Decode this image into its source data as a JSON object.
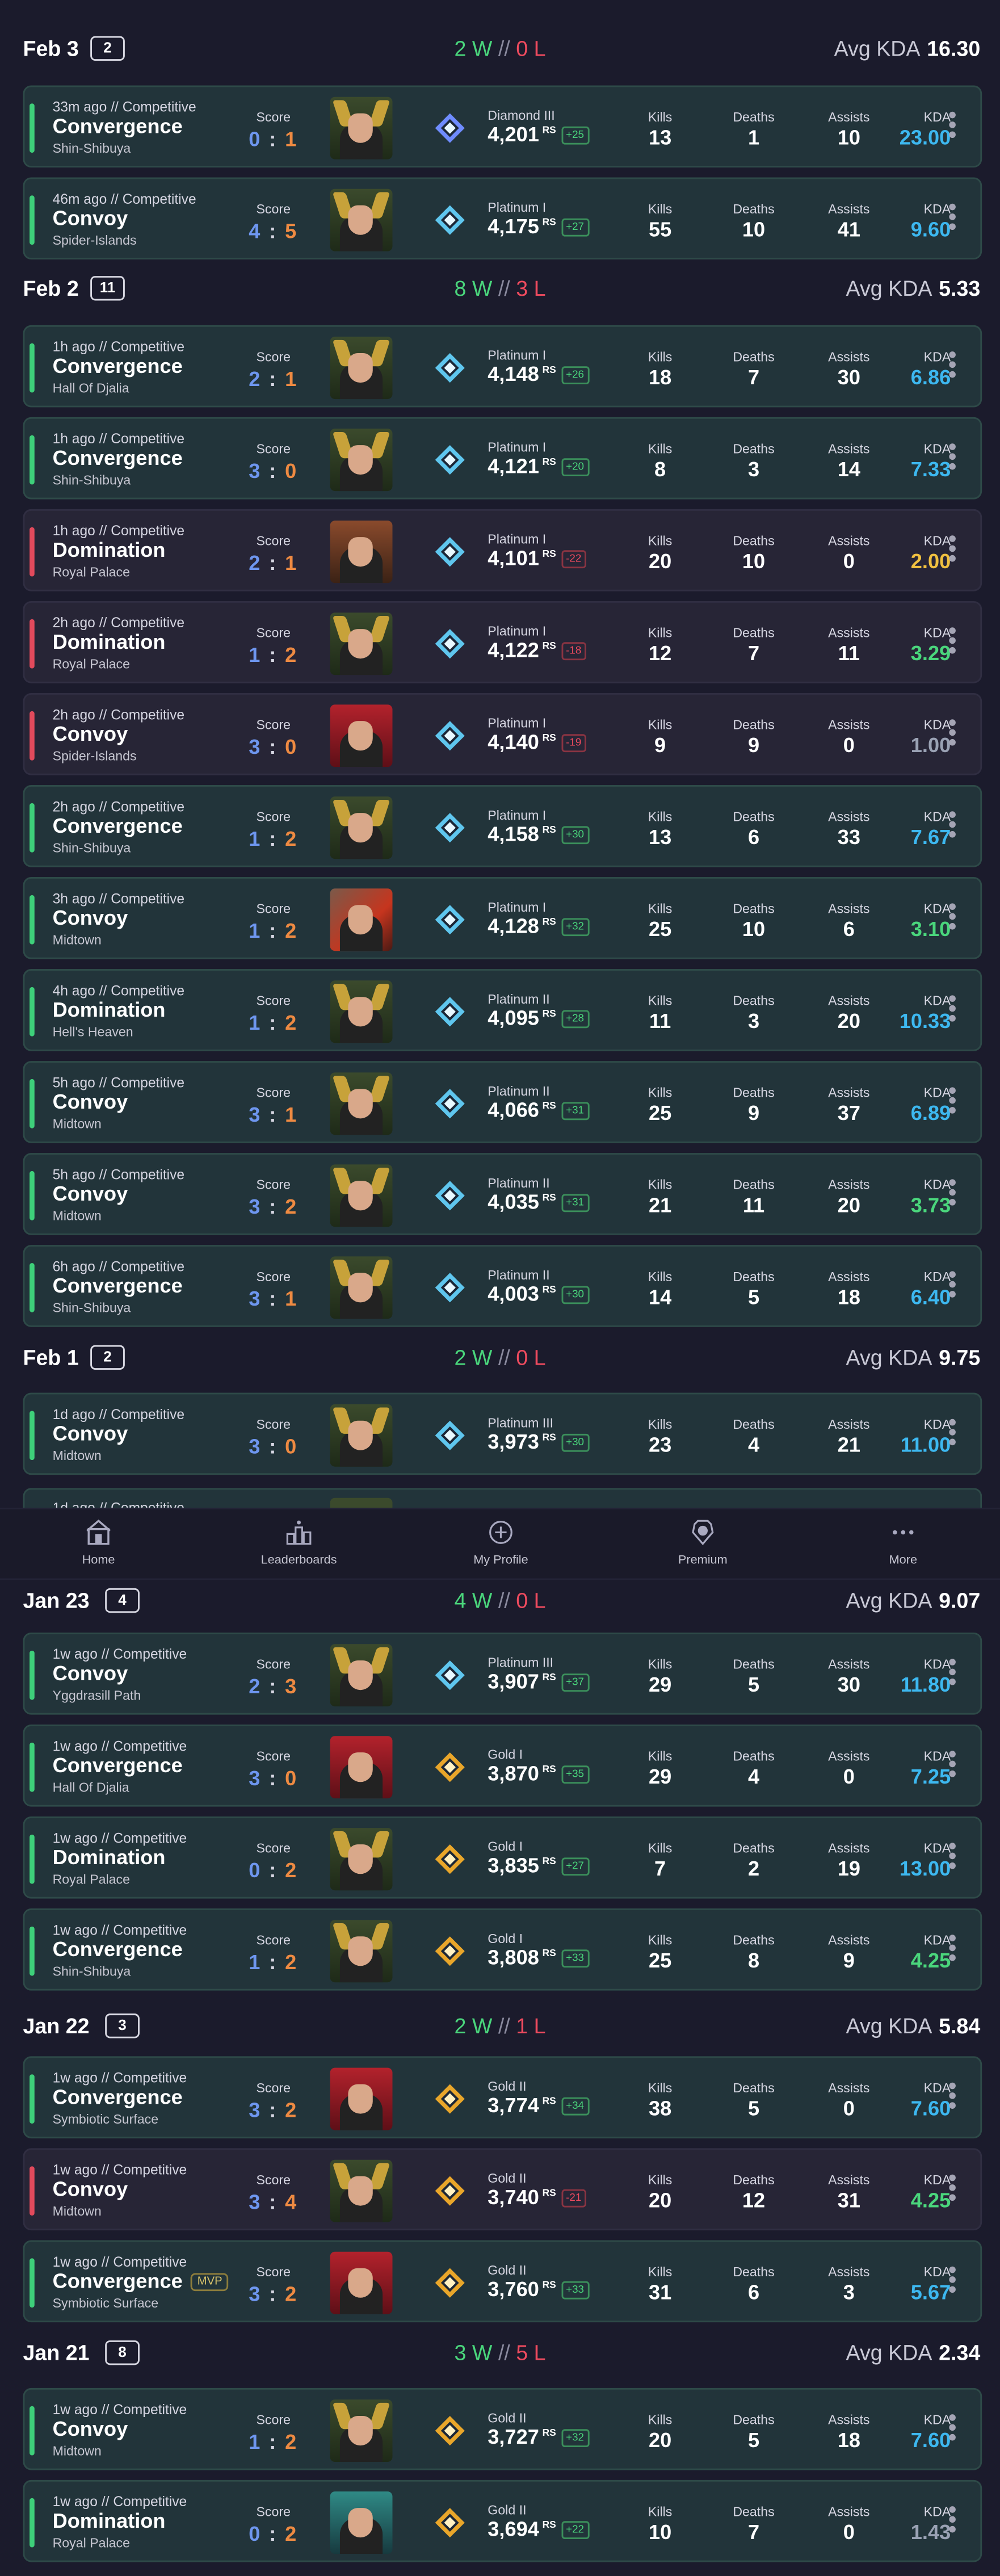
{
  "colors": {
    "background": "#1b1b2c",
    "win": "#3ed07a",
    "loss": "#e24a5c",
    "kda_blue": "#3db8f0",
    "kda_green": "#4ad67c",
    "kda_yellow": "#f0c040"
  },
  "nav": {
    "items": [
      {
        "label": "Home",
        "icon": "home-icon"
      },
      {
        "label": "Leaderboards",
        "icon": "leaderboard-icon"
      },
      {
        "label": "My Profile",
        "icon": "profile-plus-icon"
      },
      {
        "label": "Premium",
        "icon": "premium-icon"
      },
      {
        "label": "More",
        "icon": "more-dots-icon"
      }
    ]
  },
  "partial_match": {
    "meta": "1d ago // Competitive"
  },
  "days": [
    {
      "date": "Feb 3",
      "count": "2",
      "wins": "2 W",
      "sep": "//",
      "losses": "0 L",
      "avg_label": "Avg KDA",
      "avg_kda": "16.30",
      "matches": [
        {
          "time": "33m ago",
          "sep": "//",
          "queue": "Competitive",
          "mode": "Convergence",
          "map": "Shin-Shibuya",
          "score_label": "Score",
          "score_a": "0",
          "score_b": "1",
          "hero": "green",
          "rank_icon": "diamond",
          "tier": "Diamond III",
          "rs": "4,201",
          "rs_unit": "RS",
          "delta": "+25",
          "result": "win",
          "kills_label": "Kills",
          "kills": "13",
          "deaths_label": "Deaths",
          "deaths": "1",
          "assists_label": "Assists",
          "assists": "10",
          "kda_label": "KDA",
          "kda": "23.00",
          "kda_color": "blue"
        },
        {
          "time": "46m ago",
          "sep": "//",
          "queue": "Competitive",
          "mode": "Convoy",
          "map": "Spider-Islands",
          "score_label": "Score",
          "score_a": "4",
          "score_b": "5",
          "hero": "green",
          "rank_icon": "platinum",
          "tier": "Platinum I",
          "rs": "4,175",
          "rs_unit": "RS",
          "delta": "+27",
          "result": "win",
          "kills_label": "Kills",
          "kills": "55",
          "deaths_label": "Deaths",
          "deaths": "10",
          "assists_label": "Assists",
          "assists": "41",
          "kda_label": "KDA",
          "kda": "9.60",
          "kda_color": "blue"
        }
      ]
    },
    {
      "date": "Feb 2",
      "count": "11",
      "wins": "8 W",
      "sep": "//",
      "losses": "3 L",
      "avg_label": "Avg KDA",
      "avg_kda": "5.33",
      "matches": [
        {
          "time": "1h ago",
          "sep": "//",
          "queue": "Competitive",
          "mode": "Convergence",
          "map": "Hall Of Djalia",
          "score_label": "Score",
          "score_a": "2",
          "score_b": "1",
          "hero": "green",
          "rank_icon": "platinum",
          "tier": "Platinum I",
          "rs": "4,148",
          "rs_unit": "RS",
          "delta": "+26",
          "result": "win",
          "kills_label": "Kills",
          "kills": "18",
          "deaths_label": "Deaths",
          "deaths": "7",
          "assists_label": "Assists",
          "assists": "30",
          "kda_label": "KDA",
          "kda": "6.86",
          "kda_color": "blue"
        },
        {
          "time": "1h ago",
          "sep": "//",
          "queue": "Competitive",
          "mode": "Convergence",
          "map": "Shin-Shibuya",
          "score_label": "Score",
          "score_a": "3",
          "score_b": "0",
          "hero": "green",
          "rank_icon": "platinum",
          "tier": "Platinum I",
          "rs": "4,121",
          "rs_unit": "RS",
          "delta": "+20",
          "result": "win",
          "kills_label": "Kills",
          "kills": "8",
          "deaths_label": "Deaths",
          "deaths": "3",
          "assists_label": "Assists",
          "assists": "14",
          "kda_label": "KDA",
          "kda": "7.33",
          "kda_color": "blue"
        },
        {
          "time": "1h ago",
          "sep": "//",
          "queue": "Competitive",
          "mode": "Domination",
          "map": "Royal Palace",
          "score_label": "Score",
          "score_a": "2",
          "score_b": "1",
          "hero": "brown",
          "rank_icon": "platinum",
          "tier": "Platinum I",
          "rs": "4,101",
          "rs_unit": "RS",
          "delta": "-22",
          "result": "loss",
          "kills_label": "Kills",
          "kills": "20",
          "deaths_label": "Deaths",
          "deaths": "10",
          "assists_label": "Assists",
          "assists": "0",
          "kda_label": "KDA",
          "kda": "2.00",
          "kda_color": "yellow"
        },
        {
          "time": "2h ago",
          "sep": "//",
          "queue": "Competitive",
          "mode": "Domination",
          "map": "Royal Palace",
          "score_label": "Score",
          "score_a": "1",
          "score_b": "2",
          "hero": "green",
          "rank_icon": "platinum",
          "tier": "Platinum I",
          "rs": "4,122",
          "rs_unit": "RS",
          "delta": "-18",
          "result": "loss",
          "kills_label": "Kills",
          "kills": "12",
          "deaths_label": "Deaths",
          "deaths": "7",
          "assists_label": "Assists",
          "assists": "11",
          "kda_label": "KDA",
          "kda": "3.29",
          "kda_color": "green"
        },
        {
          "time": "2h ago",
          "sep": "//",
          "queue": "Competitive",
          "mode": "Convoy",
          "map": "Spider-Islands",
          "score_label": "Score",
          "score_a": "3",
          "score_b": "0",
          "hero": "red",
          "rank_icon": "platinum",
          "tier": "Platinum I",
          "rs": "4,140",
          "rs_unit": "RS",
          "delta": "-19",
          "result": "loss",
          "kills_label": "Kills",
          "kills": "9",
          "deaths_label": "Deaths",
          "deaths": "9",
          "assists_label": "Assists",
          "assists": "0",
          "kda_label": "KDA",
          "kda": "1.00",
          "kda_color": "grey"
        },
        {
          "time": "2h ago",
          "sep": "//",
          "queue": "Competitive",
          "mode": "Convergence",
          "map": "Shin-Shibuya",
          "score_label": "Score",
          "score_a": "1",
          "score_b": "2",
          "hero": "green",
          "rank_icon": "platinum",
          "tier": "Platinum I",
          "rs": "4,158",
          "rs_unit": "RS",
          "delta": "+30",
          "result": "win",
          "kills_label": "Kills",
          "kills": "13",
          "deaths_label": "Deaths",
          "deaths": "6",
          "assists_label": "Assists",
          "assists": "33",
          "kda_label": "KDA",
          "kda": "7.67",
          "kda_color": "blue"
        },
        {
          "time": "3h ago",
          "sep": "//",
          "queue": "Competitive",
          "mode": "Convoy",
          "map": "Midtown",
          "score_label": "Score",
          "score_a": "1",
          "score_b": "2",
          "hero": "mix",
          "rank_icon": "platinum",
          "tier": "Platinum I",
          "rs": "4,128",
          "rs_unit": "RS",
          "delta": "+32",
          "result": "win",
          "kills_label": "Kills",
          "kills": "25",
          "deaths_label": "Deaths",
          "deaths": "10",
          "assists_label": "Assists",
          "assists": "6",
          "kda_label": "KDA",
          "kda": "3.10",
          "kda_color": "green"
        },
        {
          "time": "4h ago",
          "sep": "//",
          "queue": "Competitive",
          "mode": "Domination",
          "map": "Hell's Heaven",
          "score_label": "Score",
          "score_a": "1",
          "score_b": "2",
          "hero": "green",
          "rank_icon": "platinum",
          "tier": "Platinum II",
          "rs": "4,095",
          "rs_unit": "RS",
          "delta": "+28",
          "result": "win",
          "kills_label": "Kills",
          "kills": "11",
          "deaths_label": "Deaths",
          "deaths": "3",
          "assists_label": "Assists",
          "assists": "20",
          "kda_label": "KDA",
          "kda": "10.33",
          "kda_color": "blue"
        },
        {
          "time": "5h ago",
          "sep": "//",
          "queue": "Competitive",
          "mode": "Convoy",
          "map": "Midtown",
          "score_label": "Score",
          "score_a": "3",
          "score_b": "1",
          "hero": "green",
          "rank_icon": "platinum",
          "tier": "Platinum II",
          "rs": "4,066",
          "rs_unit": "RS",
          "delta": "+31",
          "result": "win",
          "kills_label": "Kills",
          "kills": "25",
          "deaths_label": "Deaths",
          "deaths": "9",
          "assists_label": "Assists",
          "assists": "37",
          "kda_label": "KDA",
          "kda": "6.89",
          "kda_color": "blue"
        },
        {
          "time": "5h ago",
          "sep": "//",
          "queue": "Competitive",
          "mode": "Convoy",
          "map": "Midtown",
          "score_label": "Score",
          "score_a": "3",
          "score_b": "2",
          "hero": "green",
          "rank_icon": "platinum",
          "tier": "Platinum II",
          "rs": "4,035",
          "rs_unit": "RS",
          "delta": "+31",
          "result": "win",
          "kills_label": "Kills",
          "kills": "21",
          "deaths_label": "Deaths",
          "deaths": "11",
          "assists_label": "Assists",
          "assists": "20",
          "kda_label": "KDA",
          "kda": "3.73",
          "kda_color": "green"
        },
        {
          "time": "6h ago",
          "sep": "//",
          "queue": "Competitive",
          "mode": "Convergence",
          "map": "Shin-Shibuya",
          "score_label": "Score",
          "score_a": "3",
          "score_b": "1",
          "hero": "green",
          "rank_icon": "platinum",
          "tier": "Platinum II",
          "rs": "4,003",
          "rs_unit": "RS",
          "delta": "+30",
          "result": "win",
          "kills_label": "Kills",
          "kills": "14",
          "deaths_label": "Deaths",
          "deaths": "5",
          "assists_label": "Assists",
          "assists": "18",
          "kda_label": "KDA",
          "kda": "6.40",
          "kda_color": "blue"
        }
      ]
    },
    {
      "date": "Feb 1",
      "count": "2",
      "wins": "2 W",
      "sep": "//",
      "losses": "0 L",
      "avg_label": "Avg KDA",
      "avg_kda": "9.75",
      "matches": [
        {
          "time": "1d ago",
          "sep": "//",
          "queue": "Competitive",
          "mode": "Convoy",
          "map": "Midtown",
          "score_label": "Score",
          "score_a": "3",
          "score_b": "0",
          "hero": "green",
          "rank_icon": "platinum",
          "tier": "Platinum III",
          "rs": "3,973",
          "rs_unit": "RS",
          "delta": "+30",
          "result": "win",
          "kills_label": "Kills",
          "kills": "23",
          "deaths_label": "Deaths",
          "deaths": "4",
          "assists_label": "Assists",
          "assists": "21",
          "kda_label": "KDA",
          "kda": "11.00",
          "kda_color": "blue"
        }
      ]
    },
    {
      "date": "Jan 23",
      "count": "4",
      "wins": "4 W",
      "sep": "//",
      "losses": "0 L",
      "avg_label": "Avg KDA",
      "avg_kda": "9.07",
      "matches": [
        {
          "time": "1w ago",
          "sep": "//",
          "queue": "Competitive",
          "mode": "Convoy",
          "map": "Yggdrasill Path",
          "score_label": "Score",
          "score_a": "2",
          "score_b": "3",
          "hero": "green",
          "rank_icon": "platinum",
          "tier": "Platinum III",
          "rs": "3,907",
          "rs_unit": "RS",
          "delta": "+37",
          "result": "win",
          "kills_label": "Kills",
          "kills": "29",
          "deaths_label": "Deaths",
          "deaths": "5",
          "assists_label": "Assists",
          "assists": "30",
          "kda_label": "KDA",
          "kda": "11.80",
          "kda_color": "blue"
        },
        {
          "time": "1w ago",
          "sep": "//",
          "queue": "Competitive",
          "mode": "Convergence",
          "map": "Hall Of Djalia",
          "score_label": "Score",
          "score_a": "3",
          "score_b": "0",
          "hero": "red",
          "rank_icon": "gold",
          "tier": "Gold I",
          "rs": "3,870",
          "rs_unit": "RS",
          "delta": "+35",
          "result": "win",
          "kills_label": "Kills",
          "kills": "29",
          "deaths_label": "Deaths",
          "deaths": "4",
          "assists_label": "Assists",
          "assists": "0",
          "kda_label": "KDA",
          "kda": "7.25",
          "kda_color": "blue"
        },
        {
          "time": "1w ago",
          "sep": "//",
          "queue": "Competitive",
          "mode": "Domination",
          "map": "Royal Palace",
          "score_label": "Score",
          "score_a": "0",
          "score_b": "2",
          "hero": "green",
          "rank_icon": "gold",
          "tier": "Gold I",
          "rs": "3,835",
          "rs_unit": "RS",
          "delta": "+27",
          "result": "win",
          "kills_label": "Kills",
          "kills": "7",
          "deaths_label": "Deaths",
          "deaths": "2",
          "assists_label": "Assists",
          "assists": "19",
          "kda_label": "KDA",
          "kda": "13.00",
          "kda_color": "blue"
        },
        {
          "time": "1w ago",
          "sep": "//",
          "queue": "Competitive",
          "mode": "Convergence",
          "map": "Shin-Shibuya",
          "score_label": "Score",
          "score_a": "1",
          "score_b": "2",
          "hero": "green",
          "rank_icon": "gold",
          "tier": "Gold I",
          "rs": "3,808",
          "rs_unit": "RS",
          "delta": "+33",
          "result": "win",
          "kills_label": "Kills",
          "kills": "25",
          "deaths_label": "Deaths",
          "deaths": "8",
          "assists_label": "Assists",
          "assists": "9",
          "kda_label": "KDA",
          "kda": "4.25",
          "kda_color": "green"
        }
      ]
    },
    {
      "date": "Jan 22",
      "count": "3",
      "wins": "2 W",
      "sep": "//",
      "losses": "1 L",
      "avg_label": "Avg KDA",
      "avg_kda": "5.84",
      "matches": [
        {
          "time": "1w ago",
          "sep": "//",
          "queue": "Competitive",
          "mode": "Convergence",
          "map": "Symbiotic Surface",
          "score_label": "Score",
          "score_a": "3",
          "score_b": "2",
          "hero": "red",
          "rank_icon": "gold",
          "tier": "Gold II",
          "rs": "3,774",
          "rs_unit": "RS",
          "delta": "+34",
          "result": "win",
          "kills_label": "Kills",
          "kills": "38",
          "deaths_label": "Deaths",
          "deaths": "5",
          "assists_label": "Assists",
          "assists": "0",
          "kda_label": "KDA",
          "kda": "7.60",
          "kda_color": "blue"
        },
        {
          "time": "1w ago",
          "sep": "//",
          "queue": "Competitive",
          "mode": "Convoy",
          "map": "Midtown",
          "score_label": "Score",
          "score_a": "3",
          "score_b": "4",
          "hero": "green",
          "rank_icon": "gold",
          "tier": "Gold II",
          "rs": "3,740",
          "rs_unit": "RS",
          "delta": "-21",
          "result": "loss",
          "kills_label": "Kills",
          "kills": "20",
          "deaths_label": "Deaths",
          "deaths": "12",
          "assists_label": "Assists",
          "assists": "31",
          "kda_label": "KDA",
          "kda": "4.25",
          "kda_color": "green"
        },
        {
          "time": "1w ago",
          "sep": "//",
          "queue": "Competitive",
          "mode": "Convergence",
          "mvp": "MVP",
          "map": "Symbiotic Surface",
          "score_label": "Score",
          "score_a": "3",
          "score_b": "2",
          "hero": "red",
          "rank_icon": "gold",
          "tier": "Gold II",
          "rs": "3,760",
          "rs_unit": "RS",
          "delta": "+33",
          "result": "win",
          "kills_label": "Kills",
          "kills": "31",
          "deaths_label": "Deaths",
          "deaths": "6",
          "assists_label": "Assists",
          "assists": "3",
          "kda_label": "KDA",
          "kda": "5.67",
          "kda_color": "blue"
        }
      ]
    },
    {
      "date": "Jan 21",
      "count": "8",
      "wins": "3 W",
      "sep": "//",
      "losses": "5 L",
      "avg_label": "Avg KDA",
      "avg_kda": "2.34",
      "matches": [
        {
          "time": "1w ago",
          "sep": "//",
          "queue": "Competitive",
          "mode": "Convoy",
          "map": "Midtown",
          "score_label": "Score",
          "score_a": "1",
          "score_b": "2",
          "hero": "green",
          "rank_icon": "gold",
          "tier": "Gold II",
          "rs": "3,727",
          "rs_unit": "RS",
          "delta": "+32",
          "result": "win",
          "kills_label": "Kills",
          "kills": "20",
          "deaths_label": "Deaths",
          "deaths": "5",
          "assists_label": "Assists",
          "assists": "18",
          "kda_label": "KDA",
          "kda": "7.60",
          "kda_color": "blue"
        },
        {
          "time": "1w ago",
          "sep": "//",
          "queue": "Competitive",
          "mode": "Domination",
          "map": "Royal Palace",
          "score_label": "Score",
          "score_a": "0",
          "score_b": "2",
          "hero": "teal",
          "rank_icon": "gold",
          "tier": "Gold II",
          "rs": "3,694",
          "rs_unit": "RS",
          "delta": "+22",
          "result": "win",
          "kills_label": "Kills",
          "kills": "10",
          "deaths_label": "Deaths",
          "deaths": "7",
          "assists_label": "Assists",
          "assists": "0",
          "kda_label": "KDA",
          "kda": "1.43",
          "kda_color": "grey"
        }
      ]
    }
  ]
}
